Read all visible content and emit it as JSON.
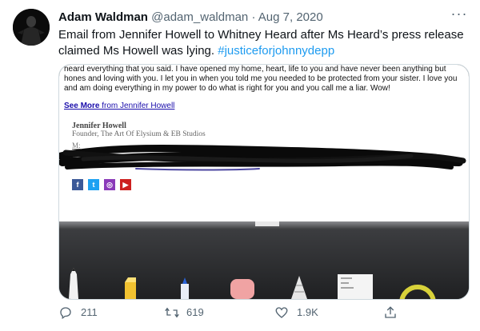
{
  "tweet": {
    "author_name": "Adam Waldman",
    "author_handle": "@adam_waldman",
    "separator": "·",
    "date": "Aug 7, 2020",
    "more_label": "···",
    "text": "Email from Jennifer Howell to Whitney Heard after Ms Heard’s press release claimed Ms Howell was lying.",
    "hashtag": "#justiceforjohnnydepp"
  },
  "email": {
    "body": "heard everything that you said. I have opened my home, heart, life to you and have never been anything but hones and loving with you. I let you in when you told me you needed to be protected from your sister. I love you and am doing everything in my power to do what is right for you and you call me a liar. Wow!",
    "see_more_bold": "See More",
    "see_more_rest": " from Jennifer Howell",
    "signature_name": "Jennifer Howell",
    "signature_title": "Founder, The Art Of Elysium & EB Studios",
    "signature_m": "M:",
    "social_icons": [
      {
        "name": "facebook-icon",
        "glyph": "f",
        "color": "#3b5998"
      },
      {
        "name": "twitter-icon",
        "glyph": "t",
        "color": "#1da1f2"
      },
      {
        "name": "instagram-icon",
        "glyph": "◎",
        "color": "#8a3ab9"
      },
      {
        "name": "youtube-icon",
        "glyph": "▶",
        "color": "#cd201f"
      }
    ]
  },
  "actions": {
    "reply_count": "211",
    "retweet_count": "619",
    "like_count": "1.9K",
    "share_icon": "share-icon"
  },
  "colors": {
    "accent": "#1d9bf0",
    "muted": "#536471",
    "link": "#1a0dab"
  }
}
